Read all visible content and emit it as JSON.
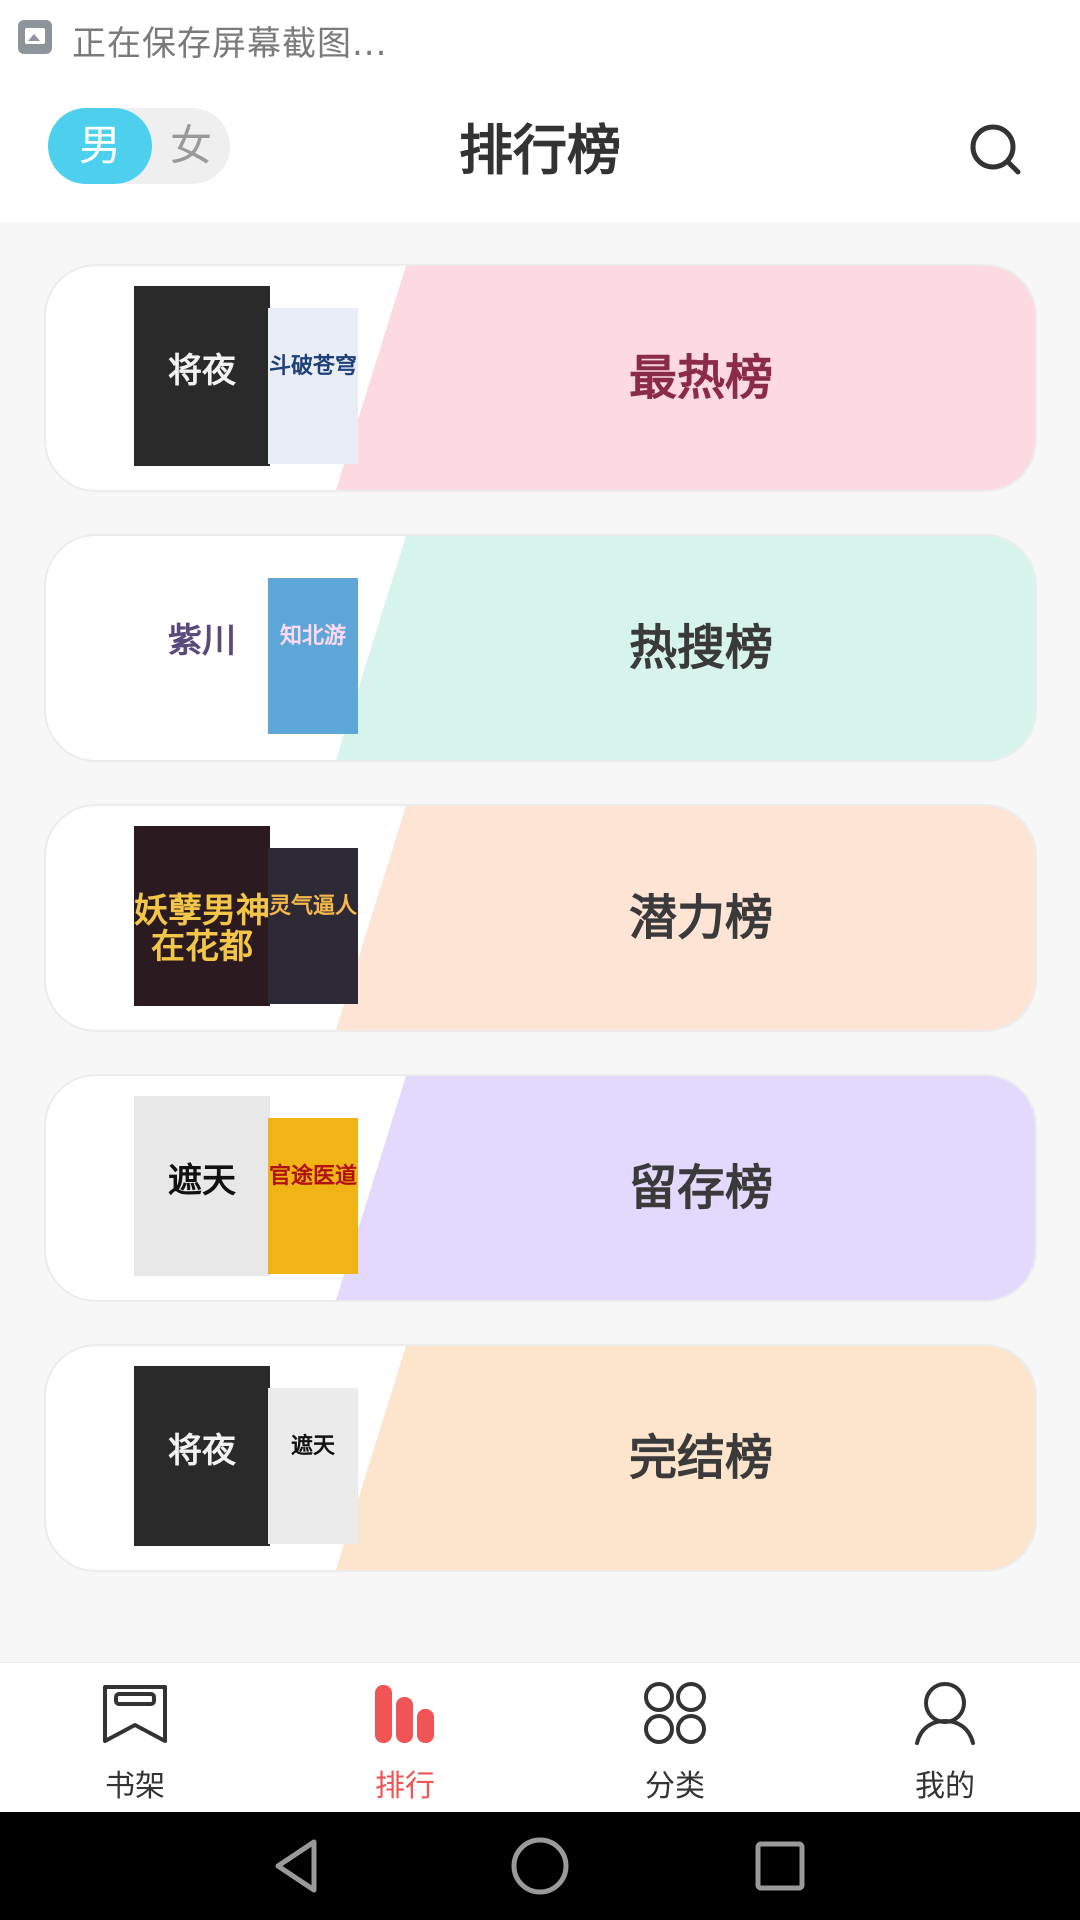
{
  "status_bar": {
    "text": "正在保存屏幕截图...",
    "icon": "screenshot-gallery-icon"
  },
  "header": {
    "title": "排行榜",
    "gender_toggle": {
      "male_label": "男",
      "female_label": "女",
      "selected": "男"
    },
    "search_icon": "search-icon"
  },
  "ranks": [
    {
      "label": "最热榜",
      "color": "#fdd9e1",
      "label_color": "#8a2b48",
      "covers": [
        {
          "title": "将夜",
          "bg": "#2a2a2a",
          "fg": "#f2f2f2"
        },
        {
          "title": "斗破苍穹",
          "bg": "#e9eef6",
          "fg": "#1f3f78"
        }
      ]
    },
    {
      "label": "热搜榜",
      "color": "#d7f4ec",
      "label_color": "#3a3a3a",
      "covers": [
        {
          "title": "紫川",
          "bg": "#ffffff",
          "fg": "#5a4a7a"
        },
        {
          "title": "知北游",
          "bg": "#5da7d8",
          "fg": "#ffd9f6"
        }
      ]
    },
    {
      "label": "潜力榜",
      "color": "#fde4d5",
      "label_color": "#3a3a3a",
      "covers": [
        {
          "title": "妖孽男神在花都",
          "bg": "#2b1b20",
          "fg": "#f3c64a"
        },
        {
          "title": "灵气逼人",
          "bg": "#2d2a35",
          "fg": "#f6b84a"
        }
      ]
    },
    {
      "label": "留存榜",
      "color": "#e3d9fd",
      "label_color": "#3a3a3a",
      "covers": [
        {
          "title": "遮天",
          "bg": "#e8e8e8",
          "fg": "#111111"
        },
        {
          "title": "官途医道",
          "bg": "#f0b515",
          "fg": "#b01010"
        }
      ]
    },
    {
      "label": "完结榜",
      "color": "#fde4cd",
      "label_color": "#3a3a3a",
      "covers": [
        {
          "title": "将夜",
          "bg": "#2a2a2a",
          "fg": "#f2f2f2"
        },
        {
          "title": "遮天",
          "bg": "#ebebeb",
          "fg": "#111111"
        }
      ]
    }
  ],
  "tabs": [
    {
      "label": "书架",
      "icon": "bookshelf-icon",
      "active": false
    },
    {
      "label": "排行",
      "icon": "ranking-icon",
      "active": true
    },
    {
      "label": "分类",
      "icon": "category-icon",
      "active": false
    },
    {
      "label": "我的",
      "icon": "profile-icon",
      "active": false
    }
  ],
  "colors": {
    "accent": "#4dd0ee",
    "active_tab": "#f05454",
    "text_dark": "#333333"
  },
  "nav_bar": {
    "buttons": [
      "back-icon",
      "home-icon",
      "recents-icon"
    ]
  }
}
